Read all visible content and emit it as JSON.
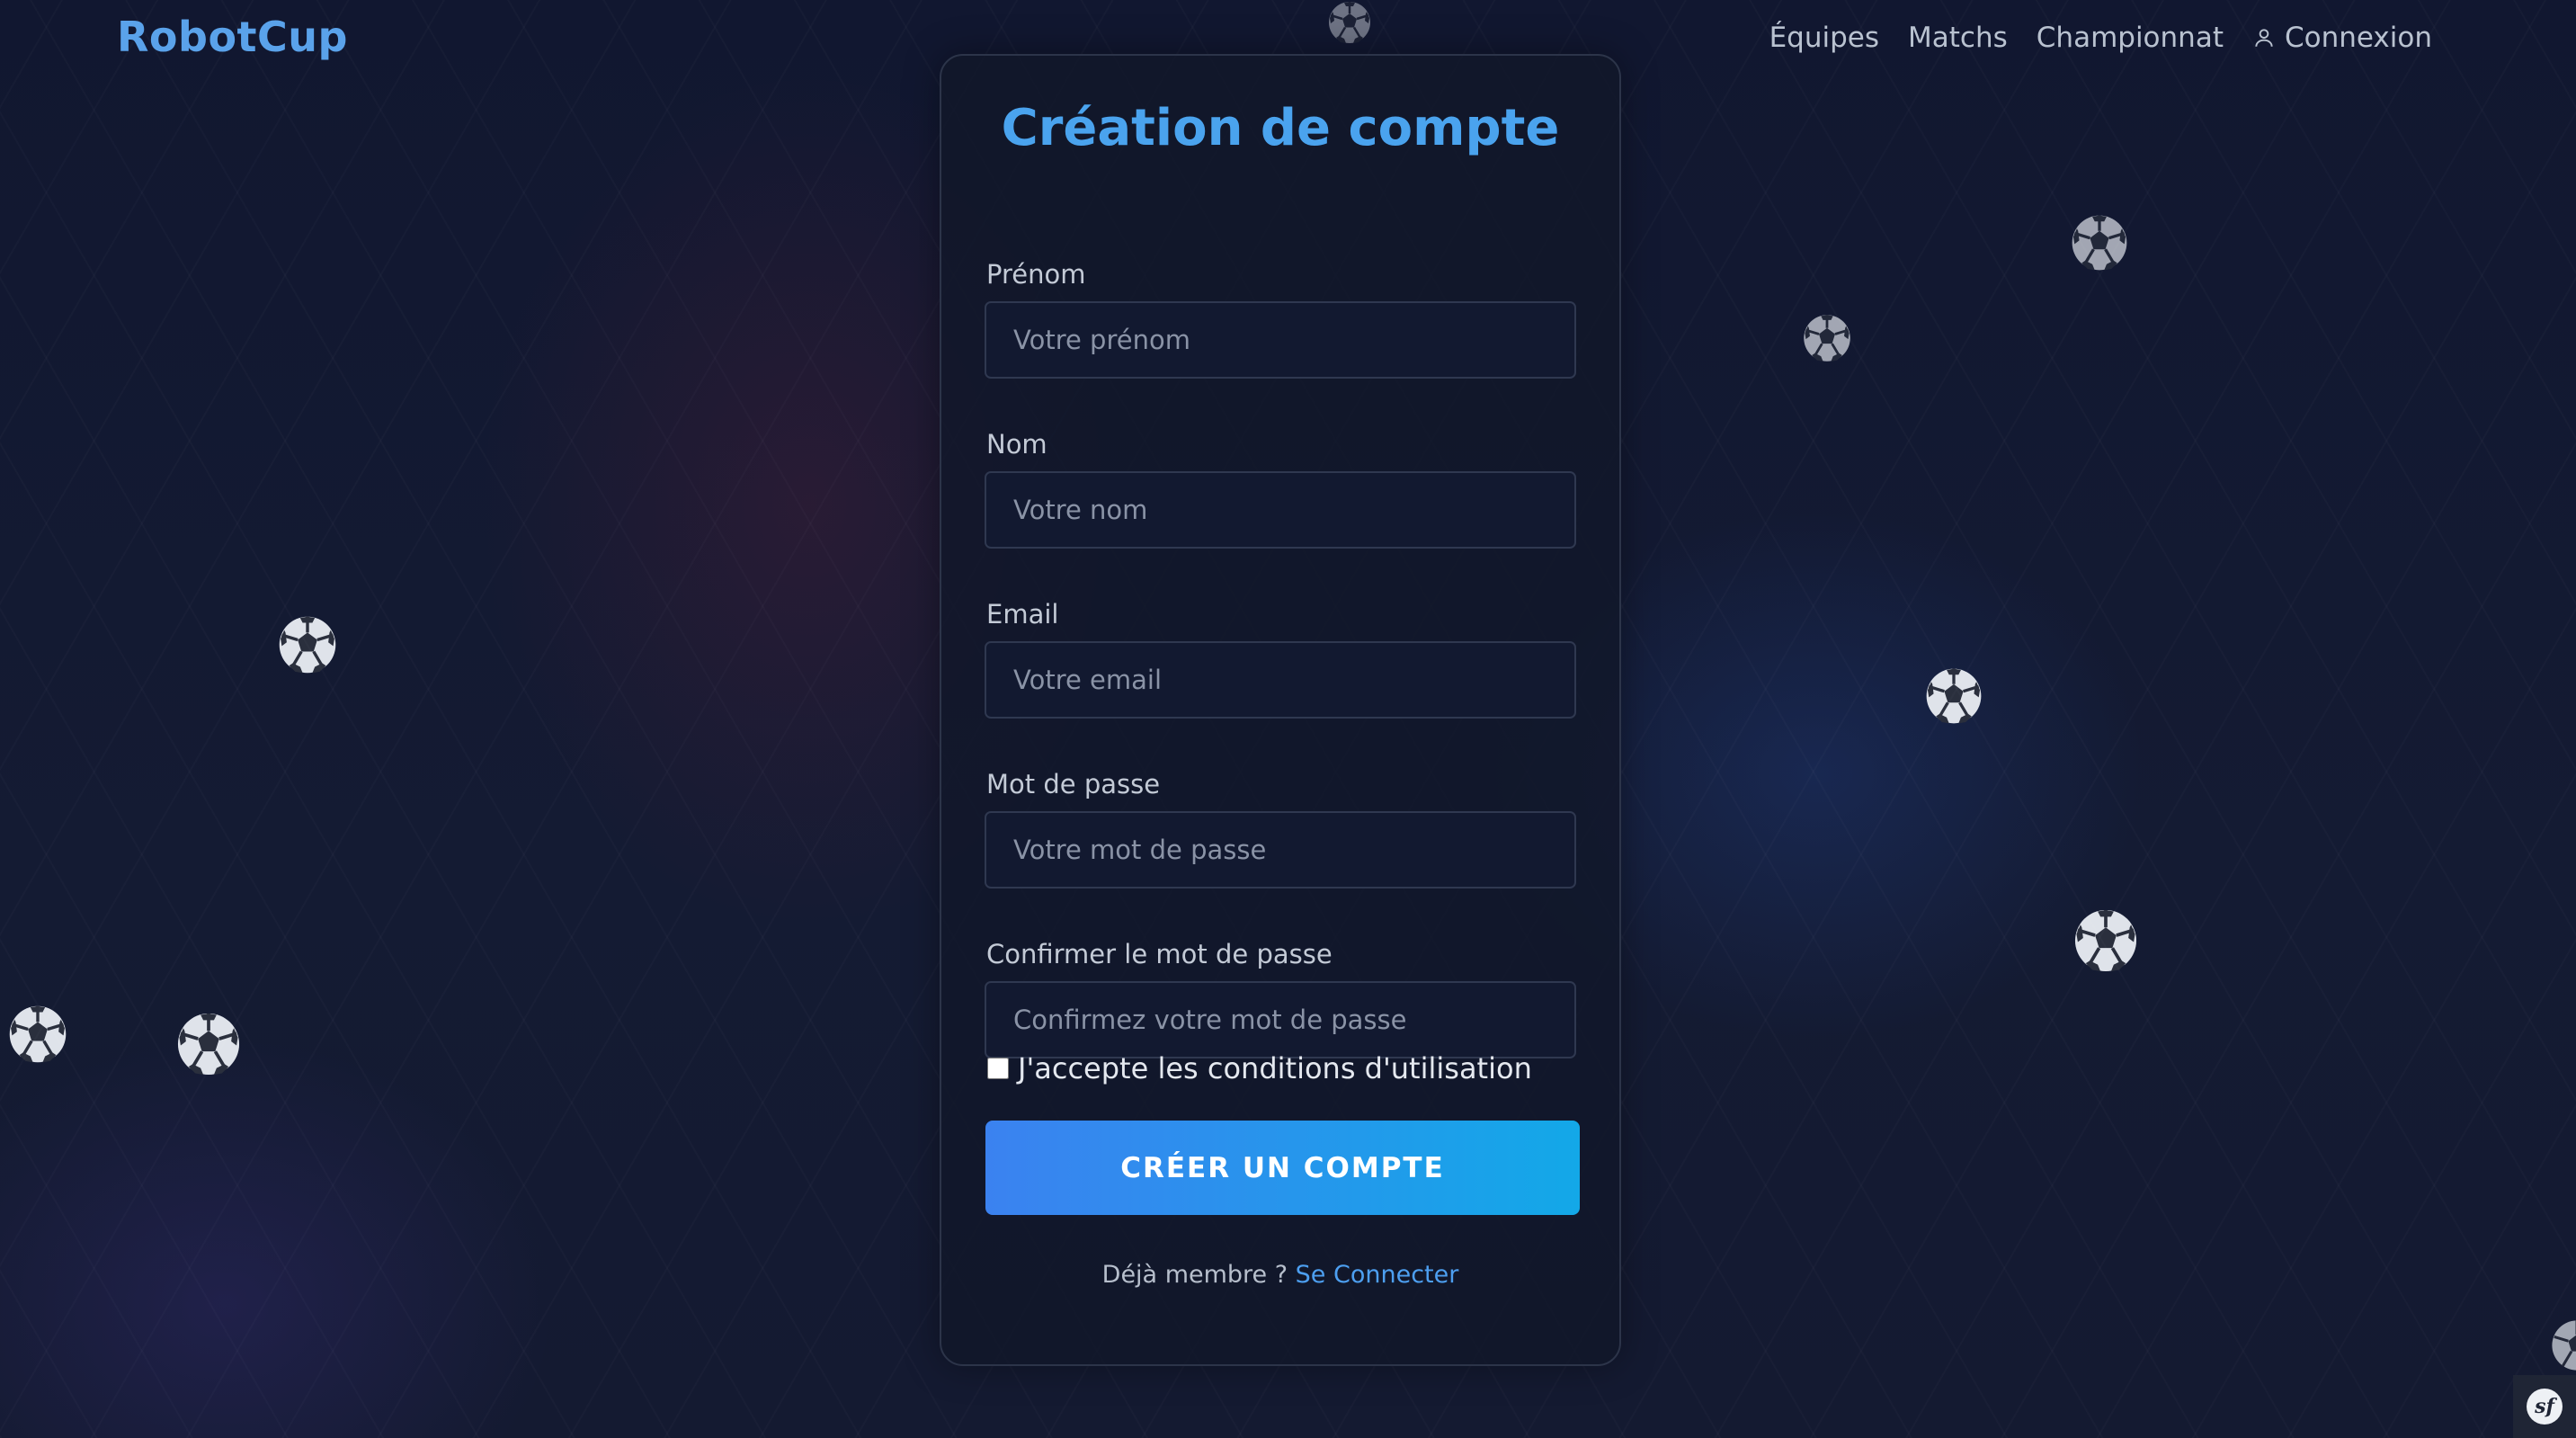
{
  "header": {
    "brand": "RobotCup",
    "nav": [
      {
        "label": "Équipes"
      },
      {
        "label": "Matchs"
      },
      {
        "label": "Championnat"
      },
      {
        "label": "Connexion",
        "icon": "user-icon"
      }
    ]
  },
  "form": {
    "title": "Création de compte",
    "fields": [
      {
        "label": "Prénom",
        "placeholder": "Votre prénom",
        "value": ""
      },
      {
        "label": "Nom",
        "placeholder": "Votre nom",
        "value": ""
      },
      {
        "label": "Email",
        "placeholder": "Votre email",
        "value": ""
      },
      {
        "label": "Mot de passe",
        "placeholder": "Votre mot de passe",
        "value": ""
      },
      {
        "label": "Confirmer le mot de passe",
        "placeholder": "Confirmez votre mot de passe",
        "value": ""
      }
    ],
    "terms_label": "J'accepte les conditions d'utilisation",
    "terms_checked": false,
    "submit_label": "CRÉER UN COMPTE",
    "footer_text": "Déjà membre ? ",
    "footer_link": "Se Connecter"
  },
  "theme": {
    "accent": "#4aa3ee",
    "button_gradient_start": "#3b82f0",
    "button_gradient_end": "#13a8e8",
    "background": "#131a2e"
  },
  "debug_toolbar": {
    "icon": "symfony-icon",
    "glyph": "sf"
  }
}
